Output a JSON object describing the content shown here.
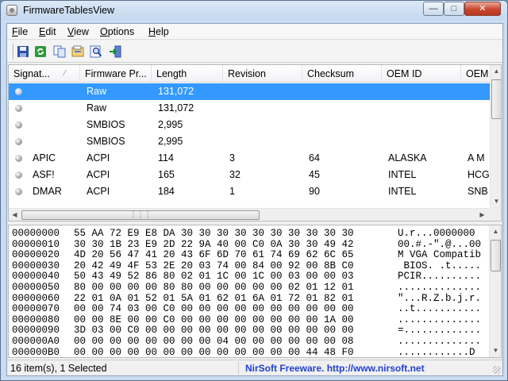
{
  "window": {
    "title": "FirmwareTablesView"
  },
  "menu": [
    "File",
    "Edit",
    "View",
    "Options",
    "Help"
  ],
  "toolbar": {
    "icons": [
      "save-icon",
      "refresh-icon",
      "copy-icon",
      "properties-icon",
      "find-icon",
      "exit-icon"
    ]
  },
  "list": {
    "columns": [
      "Signat...",
      "Firmware Pr...",
      "Length",
      "Revision",
      "Checksum",
      "OEM ID",
      "OEM"
    ],
    "rows": [
      {
        "sig": "",
        "provider": "Raw",
        "length": "131,072",
        "revision": "",
        "checksum": "",
        "oem_id": "",
        "oem": ""
      },
      {
        "sig": "",
        "provider": "Raw",
        "length": "131,072",
        "revision": "",
        "checksum": "",
        "oem_id": "",
        "oem": ""
      },
      {
        "sig": "",
        "provider": "SMBIOS",
        "length": "2,995",
        "revision": "",
        "checksum": "",
        "oem_id": "",
        "oem": ""
      },
      {
        "sig": "",
        "provider": "SMBIOS",
        "length": "2,995",
        "revision": "",
        "checksum": "",
        "oem_id": "",
        "oem": ""
      },
      {
        "sig": "APIC",
        "provider": "ACPI",
        "length": "114",
        "revision": "3",
        "checksum": "64",
        "oem_id": "ALASKA",
        "oem": "A M"
      },
      {
        "sig": "ASF!",
        "provider": "ACPI",
        "length": "165",
        "revision": "32",
        "checksum": "45",
        "oem_id": "INTEL",
        "oem": "HCG"
      },
      {
        "sig": "DMAR",
        "provider": "ACPI",
        "length": "184",
        "revision": "1",
        "checksum": "90",
        "oem_id": "INTEL",
        "oem": "SNB"
      }
    ],
    "selected_index": 0
  },
  "hex": [
    {
      "off": "00000000",
      "bytes": "55 AA 72 E9 E8 DA 30 30 30 30 30 30 30 30 30 30",
      "ascii": "U.r...0000000"
    },
    {
      "off": "00000010",
      "bytes": "30 30 1B 23 E9 2D 22 9A 40 00 C0 0A 30 30 49 42",
      "ascii": "00.#.-\".@...00"
    },
    {
      "off": "00000020",
      "bytes": "4D 20 56 47 41 20 43 6F 6D 70 61 74 69 62 6C 65",
      "ascii": "M VGA Compatib"
    },
    {
      "off": "00000030",
      "bytes": "20 42 49 4F 53 2E 20 03 74 00 84 00 92 00 8B C0",
      "ascii": " BIOS. .t....."
    },
    {
      "off": "00000040",
      "bytes": "50 43 49 52 86 80 02 01 1C 00 1C 00 03 00 00 03",
      "ascii": "PCIR.........."
    },
    {
      "off": "00000050",
      "bytes": "80 00 00 00 00 80 80 00 00 00 00 00 02 01 12 01",
      "ascii": ".............."
    },
    {
      "off": "00000060",
      "bytes": "22 01 0A 01 52 01 5A 01 62 01 6A 01 72 01 82 01",
      "ascii": "\"...R.Z.b.j.r."
    },
    {
      "off": "00000070",
      "bytes": "00 00 74 03 00 C0 00 00 00 00 00 00 00 00 00 00",
      "ascii": "..t..........."
    },
    {
      "off": "00000080",
      "bytes": "00 00 8E 00 00 C0 00 00 00 00 00 00 00 00 1A 00",
      "ascii": ".............."
    },
    {
      "off": "00000090",
      "bytes": "3D 03 00 C0 00 00 00 00 00 00 00 00 00 00 00 00",
      "ascii": "=............."
    },
    {
      "off": "000000A0",
      "bytes": "00 00 00 00 00 00 00 00 04 00 00 00 00 00 00 08",
      "ascii": ".............."
    },
    {
      "off": "000000B0",
      "bytes": "00 00 00 00 00 00 00 00 00 00 00 00 00 44 48 F0",
      "ascii": "............D"
    }
  ],
  "status": {
    "count": "16 item(s), 1 Selected",
    "link": "NirSoft Freeware.  http://www.nirsoft.net"
  }
}
